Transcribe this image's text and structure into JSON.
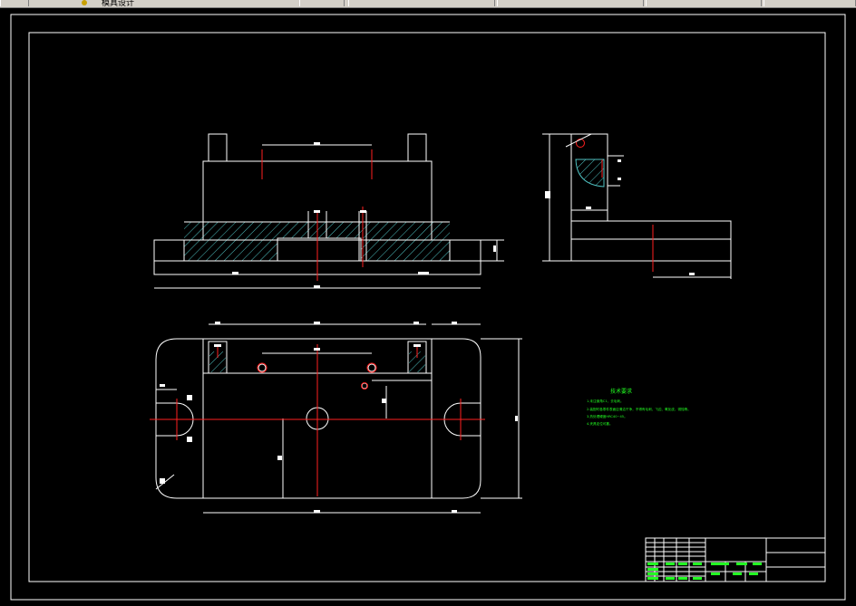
{
  "toolbar": {
    "tab_label": "模具设计"
  },
  "tech_requirements": {
    "title": "技术要求",
    "items": [
      "1.未注倒角C1，去毛刺。",
      "2.装配时各零件表面应清洁干净，不得有毛刺、飞边、氧化皮、锈蚀等。",
      "3.热处理硬度HRC40~45。",
      "4.夹具定位可靠。"
    ]
  },
  "colors": {
    "background": "#000000",
    "outline": "#ffffff",
    "center_line": "#ff2020",
    "hatch": "#4fc1c1",
    "note_text": "#22ff22",
    "toolbar": "#d4d0c8"
  }
}
